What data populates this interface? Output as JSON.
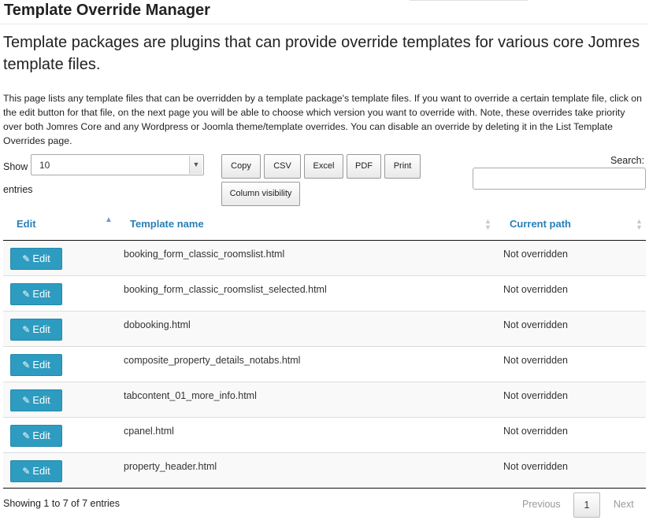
{
  "page": {
    "title": "Template Override Manager",
    "lead": "Template packages are plugins that can provide override templates for various core Jomres template files.",
    "description": "This page lists any template files that can be overridden by a template package's template files. If you want to override a certain template file, click on the edit button for that file, on the next page you will be able to choose which version you want to override with. Note, these overrides take priority over both Jomres Core and any Wordpress or Joomla theme/template overrides. You can disable an override by deleting it in the List Template Overrides page."
  },
  "controls": {
    "show_label": "Show",
    "entries_label": "entries",
    "page_length": "10",
    "search_label": "Search:",
    "search_value": "",
    "buttons": {
      "copy": "Copy",
      "csv": "CSV",
      "excel": "Excel",
      "pdf": "PDF",
      "print": "Print",
      "column_visibility": "Column visibility"
    }
  },
  "table": {
    "columns": [
      "Edit",
      "Template name",
      "Current path"
    ],
    "edit_label": "Edit",
    "rows": [
      {
        "name": "booking_form_classic_roomslist.html",
        "path": "Not overridden"
      },
      {
        "name": "booking_form_classic_roomslist_selected.html",
        "path": "Not overridden"
      },
      {
        "name": "dobooking.html",
        "path": "Not overridden"
      },
      {
        "name": "composite_property_details_notabs.html",
        "path": "Not overridden"
      },
      {
        "name": "tabcontent_01_more_info.html",
        "path": "Not overridden"
      },
      {
        "name": "cpanel.html",
        "path": "Not overridden"
      },
      {
        "name": "property_header.html",
        "path": "Not overridden"
      }
    ]
  },
  "footer": {
    "info": "Showing 1 to 7 of 7 entries",
    "previous": "Previous",
    "current_page": "1",
    "next": "Next"
  },
  "colors": {
    "accent": "#2a7fb6",
    "edit_button": "#2e9cc0"
  },
  "icons": {
    "edit": "pencil-square-icon",
    "sort_asc": "sort-ascending-icon",
    "sort_both": "sort-both-icon",
    "dropdown": "chevron-down-icon"
  }
}
